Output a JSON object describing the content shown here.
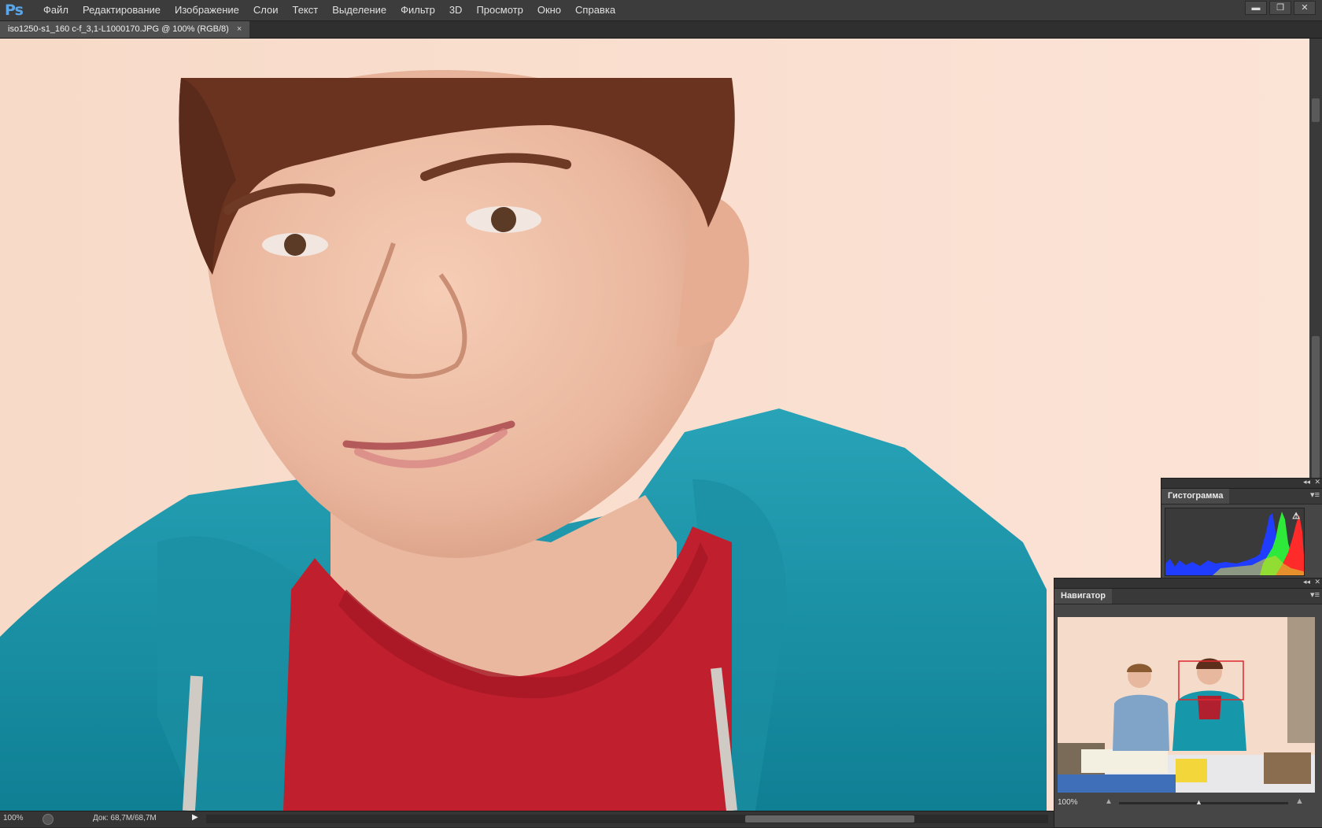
{
  "app": {
    "logo": "Ps"
  },
  "menu": [
    "Файл",
    "Редактирование",
    "Изображение",
    "Слои",
    "Текст",
    "Выделение",
    "Фильтр",
    "3D",
    "Просмотр",
    "Окно",
    "Справка"
  ],
  "window_controls": {
    "minimize": "▬",
    "restore": "❐",
    "close": "✕"
  },
  "document": {
    "tab_title": "iso1250-s1_160 c-f_3,1-L1000170.JPG @ 100% (RGB/8)",
    "close_glyph": "×"
  },
  "status": {
    "zoom": "100%",
    "doc_info": "Док: 68,7M/68,7M",
    "arrow": "▶"
  },
  "histogram_panel": {
    "title": "Гистограмма",
    "warning": "⚠",
    "collapse": "◂◂",
    "close": "✕",
    "menu": "▾≡"
  },
  "navigator_panel": {
    "title": "Навигатор",
    "zoom": "100%",
    "collapse": "◂◂",
    "close": "✕",
    "menu": "▾≡",
    "zoom_out_icon": "▲",
    "zoom_in_icon": "▲",
    "slider_value": 0.47
  }
}
